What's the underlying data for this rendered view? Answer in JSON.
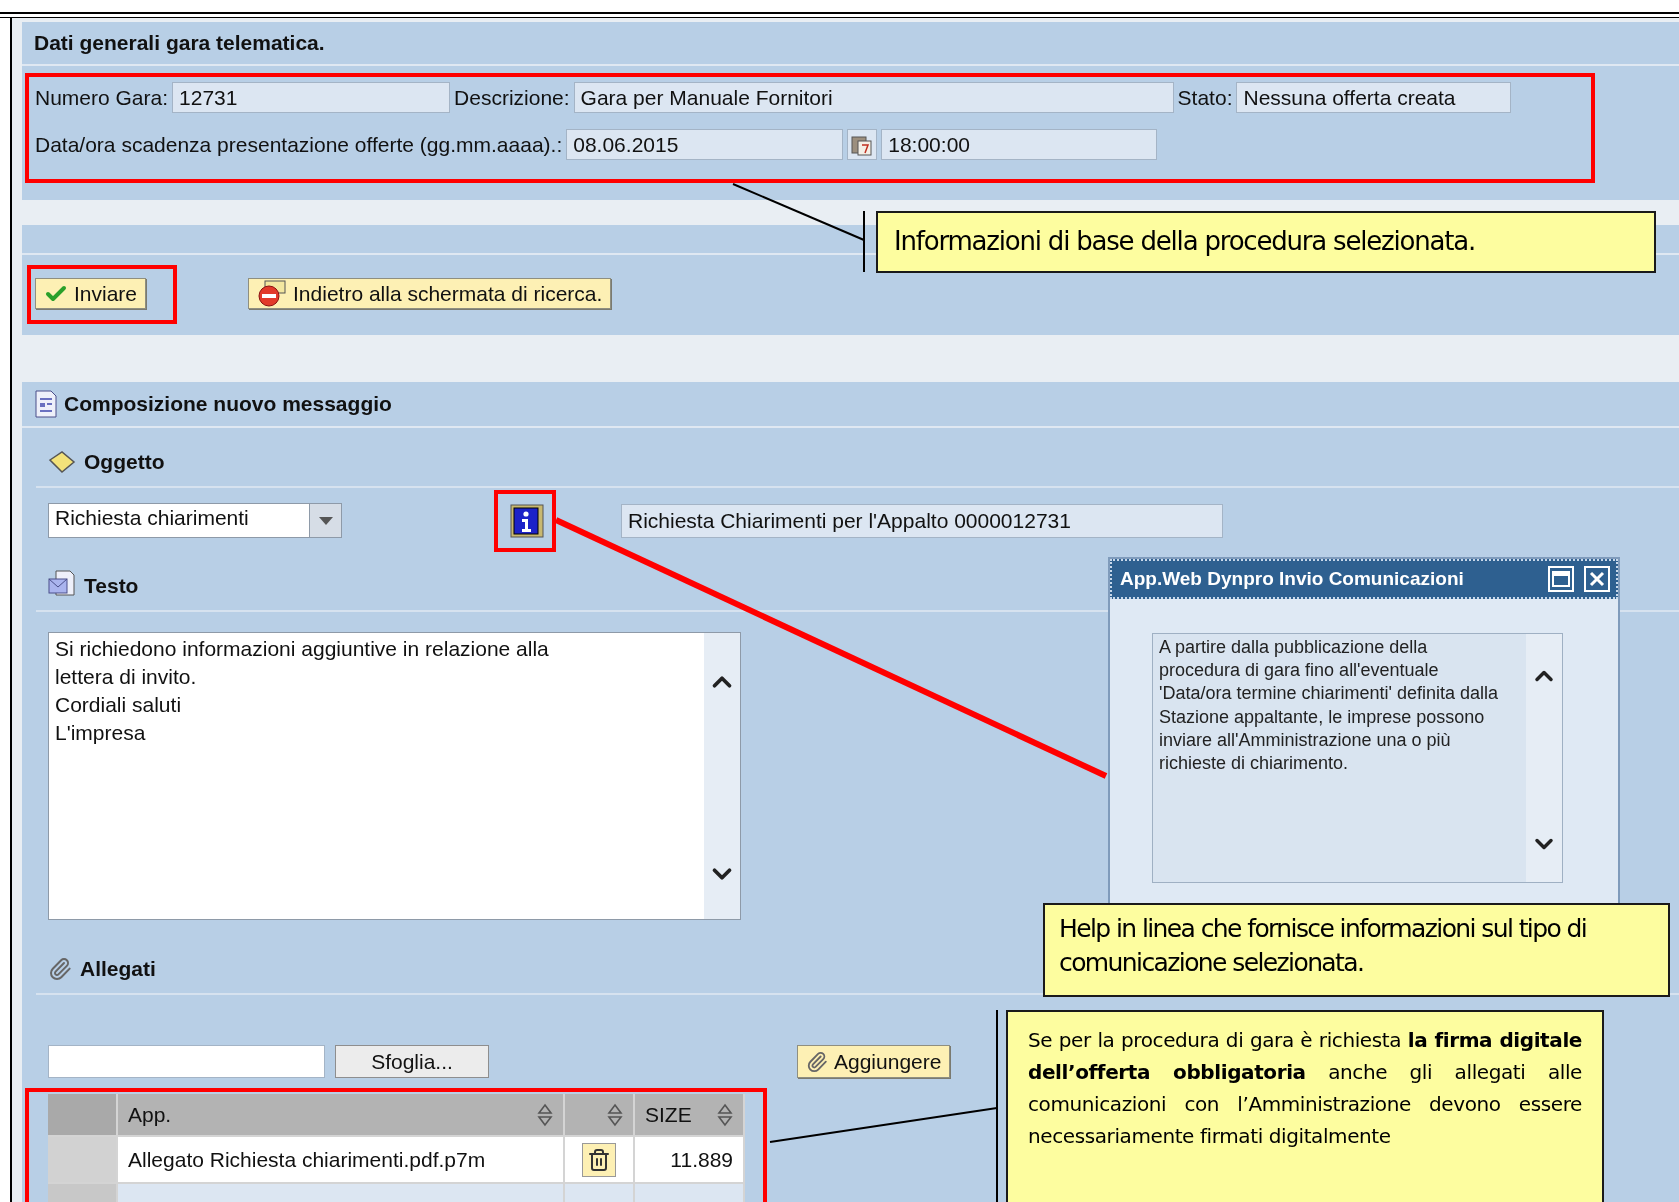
{
  "header": {
    "title": "Dati generali gara telematica."
  },
  "general_fields": [
    {
      "label": "Numero Gara:",
      "value": "12731"
    },
    {
      "label": "Descrizione:",
      "value": "Gara per Manuale Fornitori"
    },
    {
      "label": "Stato:",
      "value": "Nessuna offerta creata"
    }
  ],
  "deadline": {
    "label": "Data/ora scadenza presentazione offerte (gg.mm.aaaa).:",
    "date": "08.06.2015",
    "time": "18:00:00"
  },
  "actions": [
    {
      "kind": "send",
      "label": "Inviare"
    },
    {
      "kind": "back",
      "label": "Indietro alla schermata di ricerca."
    }
  ],
  "composer": {
    "title": "Composizione nuovo messaggio",
    "subject_section": "Oggetto",
    "subject_type": "Richiesta chiarimenti",
    "subject": "Richiesta Chiarimenti per l'Appalto 0000012731",
    "text_section": "Testo",
    "text": "Si richiedono informazioni aggiuntive in relazione alla\nlettera di invito.\nCordiali saluti\nL'impresa",
    "attachments_section": "Allegati",
    "browse_button": "Sfoglia...",
    "add_button": "Aggiungere"
  },
  "attachments_table": {
    "columns": [
      {
        "kind": "text",
        "label": "App.",
        "sortable": true
      },
      {
        "kind": "icon",
        "sortable": true
      },
      {
        "kind": "number",
        "label": "SIZE",
        "sortable": true
      }
    ],
    "rows": [
      {
        "file": "Allegato Richiesta chiarimenti.pdf.p7m",
        "size": "11.889"
      }
    ]
  },
  "popup": {
    "title": "App.Web Dynpro Invio Comunicazioni",
    "text": " A partire dalla pubblicazione della procedura di gara fino all'eventuale 'Data/ora termine chiarimenti' definita dalla Stazione appaltante, le imprese possono inviare all'Amministrazione una o più richieste di chiarimento."
  },
  "callouts": [
    {
      "text": "Informazioni di base della procedura selezionata."
    },
    {
      "text": "Help in linea che fornisce informazioni sul tipo di comunicazione selezionata."
    },
    {
      "text": "Se per la procedura di gara è richiesta **la firma digitale dell’offerta obbligatoria** anche gli allegati alle comunicazioni con l’Amministrazione devono essere necessariamente firmati digitalmente"
    }
  ]
}
